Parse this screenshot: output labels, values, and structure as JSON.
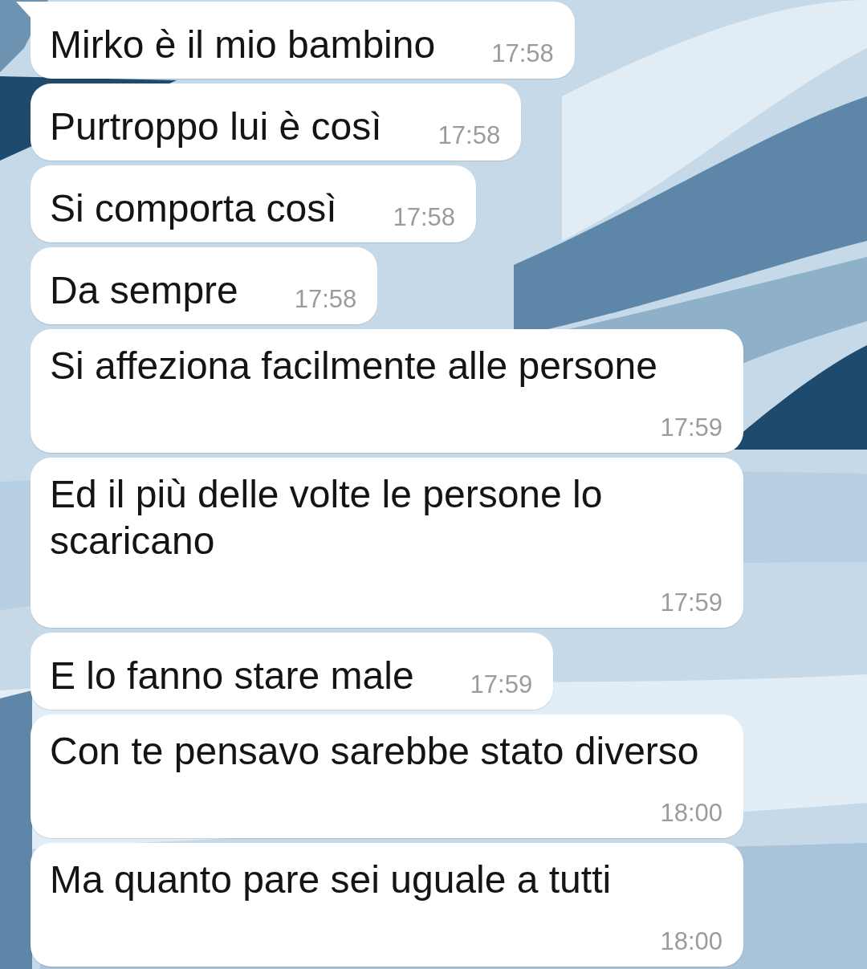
{
  "messages": [
    {
      "text": "Mirko è il mio bambino",
      "time": "17:58",
      "tail": true
    },
    {
      "text": "Purtroppo lui è così",
      "time": "17:58",
      "tail": false
    },
    {
      "text": "Si comporta così",
      "time": "17:58",
      "tail": false
    },
    {
      "text": "Da sempre",
      "time": "17:58",
      "tail": false
    },
    {
      "text": "Si affeziona facilmente alle persone",
      "time": "17:59",
      "tail": false
    },
    {
      "text": "Ed il più delle volte le persone lo scaricano",
      "time": "17:59",
      "tail": false
    },
    {
      "text": "E lo fanno stare male",
      "time": "17:59",
      "tail": false
    },
    {
      "text": "Con te pensavo sarebbe stato diverso",
      "time": "18:00",
      "tail": false
    },
    {
      "text": "Ma quanto pare sei uguale a tutti",
      "time": "18:00",
      "tail": false
    }
  ]
}
